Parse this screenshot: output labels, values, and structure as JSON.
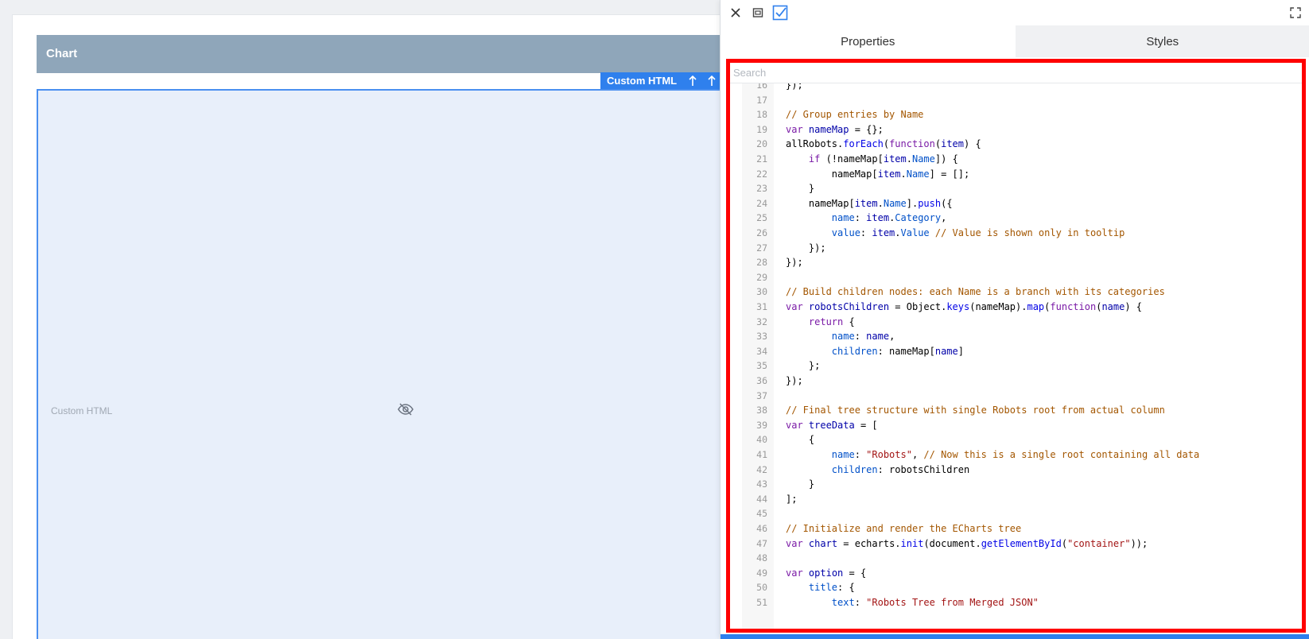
{
  "canvas": {
    "chart_title": "Chart",
    "widget_label": "Custom HTML",
    "placeholder": "Custom HTML"
  },
  "panel": {
    "tabs": [
      "Properties",
      "Styles"
    ],
    "search_placeholder": "Search",
    "code_lines": [
      {
        "n": "16",
        "html": "});"
      },
      {
        "n": "17",
        "html": ""
      },
      {
        "n": "18",
        "html": "<span class='c-com'>// Group entries by Name</span>"
      },
      {
        "n": "19",
        "html": "<span class='c-kw'>var</span> <span class='c-var'>nameMap</span> = {};"
      },
      {
        "n": "20",
        "html": "allRobots.<span class='c-fn'>forEach</span>(<span class='c-kw'>function</span>(<span class='c-var'>item</span>) {"
      },
      {
        "n": "21",
        "html": "    <span class='c-kw'>if</span> (!nameMap[<span class='c-var'>item</span>.<span class='c-prop'>Name</span>]) {"
      },
      {
        "n": "22",
        "html": "        nameMap[<span class='c-var'>item</span>.<span class='c-prop'>Name</span>] = [];"
      },
      {
        "n": "23",
        "html": "    }"
      },
      {
        "n": "24",
        "html": "    nameMap[<span class='c-var'>item</span>.<span class='c-prop'>Name</span>].<span class='c-fn'>push</span>({"
      },
      {
        "n": "25",
        "html": "        <span class='c-prop'>name</span>: <span class='c-var'>item</span>.<span class='c-prop'>Category</span>,"
      },
      {
        "n": "26",
        "html": "        <span class='c-prop'>value</span>: <span class='c-var'>item</span>.<span class='c-prop'>Value</span> <span class='c-com'>// Value is shown only in tooltip</span>"
      },
      {
        "n": "27",
        "html": "    });"
      },
      {
        "n": "28",
        "html": "});"
      },
      {
        "n": "29",
        "html": ""
      },
      {
        "n": "30",
        "html": "<span class='c-com'>// Build children nodes: each Name is a branch with its categories</span>"
      },
      {
        "n": "31",
        "html": "<span class='c-kw'>var</span> <span class='c-var'>robotsChildren</span> = Object.<span class='c-fn'>keys</span>(nameMap).<span class='c-fn'>map</span>(<span class='c-kw'>function</span>(<span class='c-var'>name</span>) {"
      },
      {
        "n": "32",
        "html": "    <span class='c-kw'>return</span> {"
      },
      {
        "n": "33",
        "html": "        <span class='c-prop'>name</span>: <span class='c-var'>name</span>,"
      },
      {
        "n": "34",
        "html": "        <span class='c-prop'>children</span>: nameMap[<span class='c-var'>name</span>]"
      },
      {
        "n": "35",
        "html": "    };"
      },
      {
        "n": "36",
        "html": "});"
      },
      {
        "n": "37",
        "html": ""
      },
      {
        "n": "38",
        "html": "<span class='c-com'>// Final tree structure with single Robots root from actual column</span>"
      },
      {
        "n": "39",
        "html": "<span class='c-kw'>var</span> <span class='c-var'>treeData</span> = ["
      },
      {
        "n": "40",
        "html": "    {"
      },
      {
        "n": "41",
        "html": "        <span class='c-prop'>name</span>: <span class='c-str'>\"Robots\"</span>, <span class='c-com'>// Now this is a single root containing all data</span>"
      },
      {
        "n": "42",
        "html": "        <span class='c-prop'>children</span>: robotsChildren"
      },
      {
        "n": "43",
        "html": "    }"
      },
      {
        "n": "44",
        "html": "];"
      },
      {
        "n": "45",
        "html": ""
      },
      {
        "n": "46",
        "html": "<span class='c-com'>// Initialize and render the ECharts tree</span>"
      },
      {
        "n": "47",
        "html": "<span class='c-kw'>var</span> <span class='c-var'>chart</span> = echarts.<span class='c-fn'>init</span>(document.<span class='c-fn'>getElementById</span>(<span class='c-str'>\"container\"</span>));"
      },
      {
        "n": "48",
        "html": ""
      },
      {
        "n": "49",
        "html": "<span class='c-kw'>var</span> <span class='c-var'>option</span> = {"
      },
      {
        "n": "50",
        "html": "    <span class='c-prop'>title</span>: {"
      },
      {
        "n": "51",
        "html": "        <span class='c-prop'>text</span>: <span class='c-str'>\"Robots Tree from Merged JSON\"</span>"
      }
    ]
  },
  "colors": {
    "accent": "#2f80ed",
    "header": "#8fa6ba",
    "highlight_border": "#ff0000"
  }
}
